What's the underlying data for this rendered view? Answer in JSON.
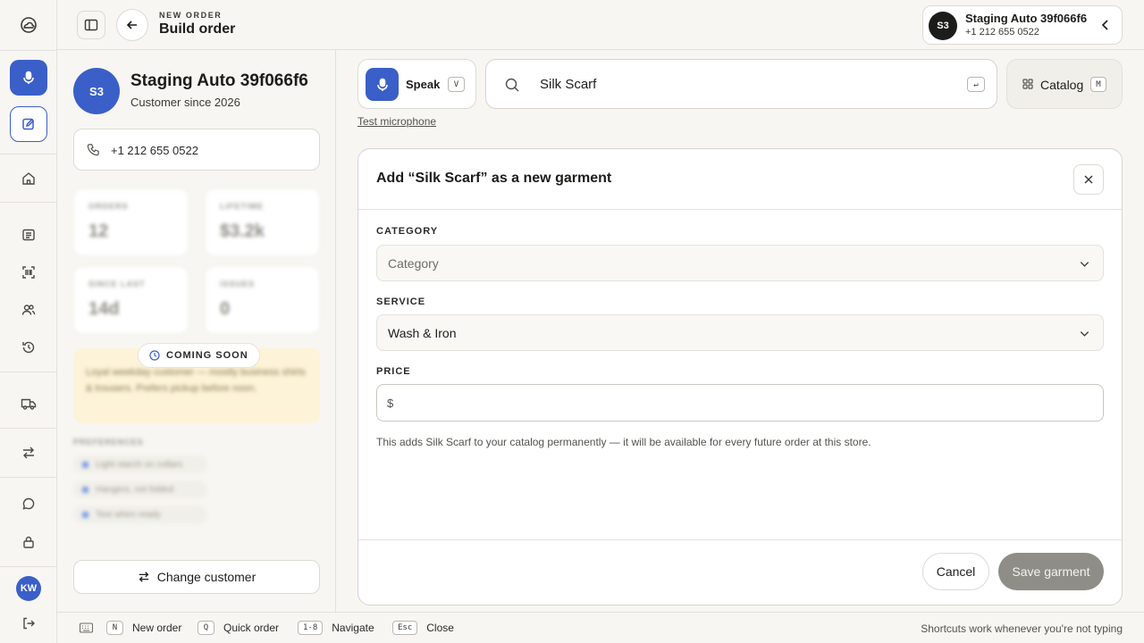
{
  "rail": {
    "avatar_initials": "KW",
    "icons": [
      "cloud-logo-icon",
      "microphone-icon",
      "edit-order-icon",
      "home-icon",
      "orders-list-icon",
      "barcode-scan-icon",
      "customers-icon",
      "history-icon",
      "delivery-truck-icon",
      "transfer-icon",
      "chat-icon",
      "lock-icon",
      "sign-out-icon"
    ]
  },
  "header": {
    "eyebrow": "NEW ORDER",
    "title": "Build order"
  },
  "customer": {
    "initials": "S3",
    "name": "Staging Auto 39f066f6",
    "phone": "+1 212 655 0522",
    "since": "Customer since 2026",
    "stats": [
      {
        "label": "ORDERS",
        "value": "12"
      },
      {
        "label": "LIFETIME",
        "value": "$3.2k"
      },
      {
        "label": "SINCE LAST",
        "value": "14d"
      },
      {
        "label": "ISSUES",
        "value": "0"
      }
    ],
    "coming_soon": {
      "label": "COMING SOON",
      "blurred_text": "Loyal weekday customer — mostly business shirts & trousers. Prefers pickup before noon."
    },
    "preferences": {
      "heading": "PREFERENCES",
      "items": [
        "Light starch on collars",
        "Hangers, not folded",
        "Text when ready"
      ]
    },
    "change_button": "Change customer"
  },
  "input_bar": {
    "speak_label": "Speak",
    "speak_key": "V",
    "test_mic": "Test microphone",
    "search_value": "Silk Scarf",
    "search_key": "↵",
    "catalog_label": "Catalog",
    "catalog_key": "M"
  },
  "dialog": {
    "title": "Add “Silk Scarf” as a new garment",
    "category_label": "CATEGORY",
    "category_placeholder": "Category",
    "service_label": "SERVICE",
    "service_value": "Wash & Iron",
    "price_label": "PRICE",
    "price_currency": "$",
    "price_value": "",
    "note": "This adds Silk Scarf to your catalog permanently — it will be available for every future order at this store.",
    "cancel": "Cancel",
    "save": "Save garment"
  },
  "shortcuts": {
    "items": [
      {
        "key": "N",
        "label": "New order"
      },
      {
        "key": "Q",
        "label": "Quick order"
      },
      {
        "key": "1-8",
        "label": "Navigate"
      },
      {
        "key": "Esc",
        "label": "Close"
      }
    ],
    "hint": "Shortcuts work whenever you're not typing"
  },
  "colors": {
    "accent": "#3a5fc8",
    "background": "#f7f6f2",
    "save_disabled": "#8f8d87",
    "coming_soon_bg": "#fdf3d8"
  }
}
